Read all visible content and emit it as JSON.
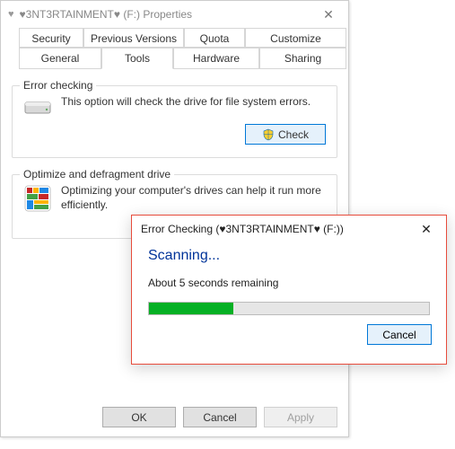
{
  "properties": {
    "title": "♥3NT3RTAINMENT♥ (F:) Properties",
    "close_glyph": "✕",
    "tabs": {
      "security": "Security",
      "previous_versions": "Previous Versions",
      "quota": "Quota",
      "customize": "Customize",
      "general": "General",
      "tools": "Tools",
      "hardware": "Hardware",
      "sharing": "Sharing"
    },
    "error_checking": {
      "title": "Error checking",
      "text": "This option will check the drive for file system errors.",
      "button": "Check"
    },
    "optimize": {
      "title": "Optimize and defragment drive",
      "text": "Optimizing your computer's drives can help it run more efficiently."
    },
    "buttons": {
      "ok": "OK",
      "cancel": "Cancel",
      "apply": "Apply"
    }
  },
  "modal": {
    "title": "Error Checking (♥3NT3RTAINMENT♥ (F:))",
    "close_glyph": "✕",
    "scanning": "Scanning...",
    "remaining": "About 5 seconds remaining",
    "progress_percent": 30,
    "cancel": "Cancel"
  }
}
